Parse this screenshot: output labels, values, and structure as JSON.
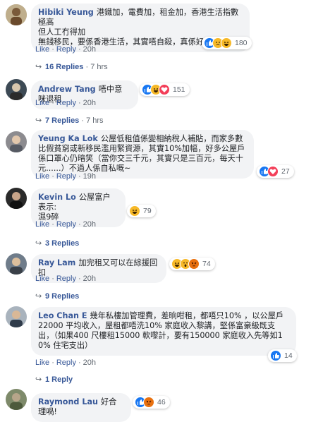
{
  "comments": [
    {
      "author": "Hibiki Yeung",
      "text_line1": "港鐵加，電費加，租金加，香港生活指數極高",
      "text_line2": "但人工冇得加",
      "text_line3": "無錢移民，要係香港生活，其實唔自殺，真係好堅強.",
      "like": "Like",
      "reply": "Reply",
      "time": "20h",
      "reactions": "180",
      "replies": "16 Replies",
      "replies_time": "7 hrs"
    },
    {
      "author": "Andrew Tang",
      "text": "唔中意咪退租",
      "like": "Like",
      "reply": "Reply",
      "time": "20h",
      "reactions": "151",
      "replies": "7 Replies",
      "replies_time": "7 hrs"
    },
    {
      "author": "Yeung Ka Lok",
      "text": "公屋低租值係變相納稅人補貼，而家多數比假貧窮或新移民濫用緊資源，其實10%加幅，好多公屋戶係口罩心仍暗笑（當你交三千元，其實只是三百元，每天十元......）不過人係自私嘅~",
      "like": "Like",
      "reply": "Reply",
      "time": "19h",
      "reactions": "27"
    },
    {
      "author": "Kevin Lo",
      "text_line1": "公屋富户表示:",
      "text_line2": "濕9碎",
      "like": "Like",
      "reply": "Reply",
      "time": "20h",
      "reactions": "79",
      "replies": "3 Replies"
    },
    {
      "author": "Ray Lam",
      "text": "加完租又可以在綜援回扣",
      "like": "Like",
      "reply": "Reply",
      "time": "20h",
      "reactions": "74",
      "replies": "9 Replies"
    },
    {
      "author": "Leo Chan E",
      "text": "幾年私樓加管理費，差晌咁租，都唔只10% ，以公屋戶22000 平均收入，屋租都唔洗10% 家庭收入黎講，堅係富豪級既支出，（如果400 尺樓租15000 軟嚟計，要有150000 家庭收入先等如10% 住宅支出）",
      "like": "Like",
      "reply": "Reply",
      "time": "20h",
      "reactions": "14",
      "replies": "1 Reply"
    },
    {
      "author": "Raymond Lau",
      "text": "好合理喎!",
      "reactions": "46"
    }
  ],
  "colors": {
    "link": "#385898",
    "bubble": "#f2f3f5",
    "meta": "#606770",
    "like_blue": "#1877f2",
    "haha_yellow": "#f7b928",
    "love_red": "#f33e58",
    "angry_orange": "#e9710f"
  },
  "icons": {
    "like": "thumbs-up-icon",
    "haha": "laughing-face-icon",
    "wow": "surprised-face-icon",
    "sad": "sad-face-icon",
    "angry": "angry-face-icon",
    "love": "heart-icon",
    "reply_arrow": "reply-arrow-icon"
  }
}
